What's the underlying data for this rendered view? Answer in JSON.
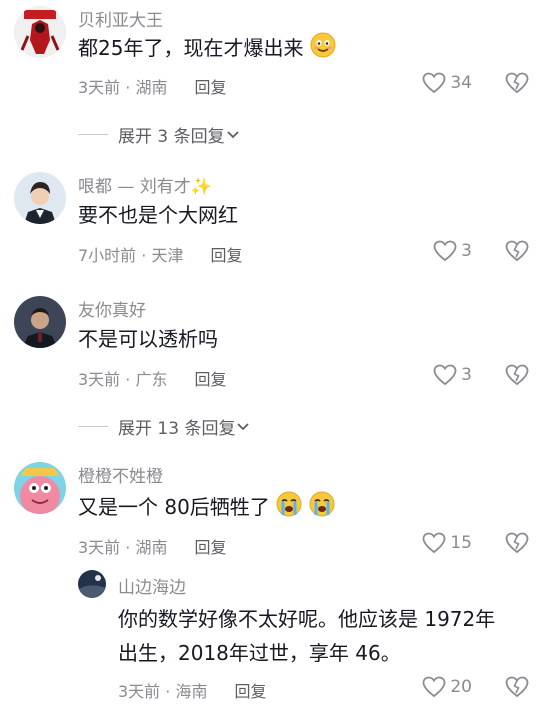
{
  "comments": [
    {
      "author": "贝利亚大王",
      "text": "都25年了，现在才爆出来",
      "time_loc": "3天前 · 湖南",
      "reply": "回复",
      "likes": "34",
      "expand": "展开 3 条回复"
    },
    {
      "author": "哏都 — 刘有才✨",
      "text": "要不也是个大网红",
      "time_loc": "7小时前 · 天津",
      "reply": "回复",
      "likes": "3"
    },
    {
      "author": "友你真好",
      "text": "不是可以透析吗",
      "time_loc": "3天前 · 广东",
      "reply": "回复",
      "likes": "3",
      "expand": "展开 13 条回复"
    },
    {
      "author": "橙橙不姓橙",
      "text": "又是一个 80后牺牲了",
      "time_loc": "3天前 · 湖南",
      "reply": "回复",
      "likes": "15"
    }
  ],
  "sub_reply": {
    "author": "山边海边",
    "text_line1": "你的数学好像不太好呢。他应该是 1972年",
    "text_line2": "出生，2018年过世，享年 46。",
    "time_loc": "3天前 · 海南",
    "reply": "回复",
    "likes": "20"
  },
  "colors": {
    "secondary_text": "#8a8b91",
    "primary_text": "#161823"
  },
  "icons": [
    "heart-icon",
    "broken-heart-icon",
    "chevron-down-icon",
    "smile-emoji",
    "crying-emoji"
  ]
}
